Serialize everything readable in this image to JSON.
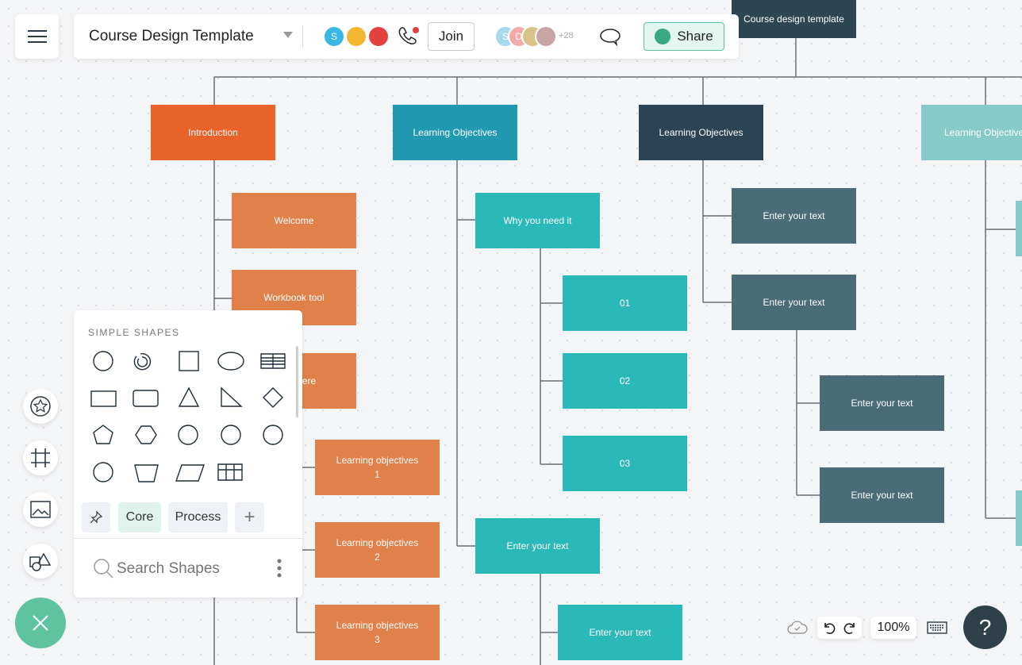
{
  "header": {
    "title": "Course Design Template",
    "join_label": "Join",
    "share_label": "Share",
    "collaborators_initials": [
      "S",
      "D"
    ],
    "active_user_initial": "S",
    "more_count": "+28"
  },
  "diagram": {
    "root": "Course design template",
    "columns": [
      {
        "title": "Introduction",
        "children": [
          "Welcome",
          "Workbook tool",
          "Where"
        ],
        "sub": [
          "Learning objectives\n1",
          "Learning objectives\n2",
          "Learning objectives\n3"
        ]
      },
      {
        "title": "Learning Objectives",
        "children": [
          "Why you need it",
          "Enter your text"
        ],
        "sub": [
          "01",
          "02",
          "03"
        ],
        "sub2": [
          "Enter your text"
        ]
      },
      {
        "title": "Learning Objectives",
        "children": [
          "Enter your text",
          "Enter your text"
        ],
        "sub": [
          "Enter your text",
          "Enter your text"
        ]
      },
      {
        "title": "Learning Objective"
      }
    ],
    "colors": {
      "intro": "#e8622a",
      "orange": "#e08149",
      "teal_dark": "#2199b0",
      "teal": "#2ab8b8",
      "navy": "#2b4455",
      "slate": "#4a6b78",
      "teal_light": "#86cbc9"
    }
  },
  "shapes_panel": {
    "section_title": "SIMPLE SHAPES",
    "tabs": [
      "Core",
      "Process"
    ],
    "search_placeholder": "Search Shapes"
  },
  "bottom_bar": {
    "zoom": "100%"
  }
}
